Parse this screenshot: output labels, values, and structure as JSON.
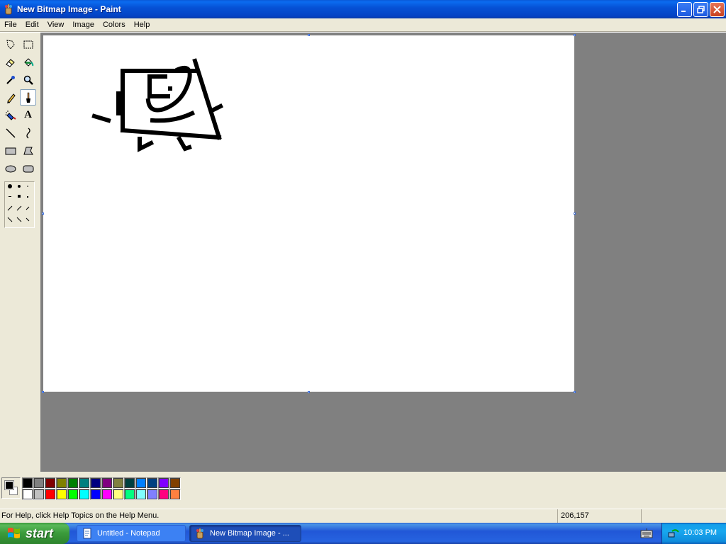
{
  "window": {
    "title": "New Bitmap Image - Paint",
    "buttons": {
      "minimize": "minimize-icon",
      "restore": "restore-icon",
      "close": "close-icon"
    }
  },
  "menu": [
    "File",
    "Edit",
    "View",
    "Image",
    "Colors",
    "Help"
  ],
  "tools": [
    {
      "name": "free-form-select-icon"
    },
    {
      "name": "select-icon"
    },
    {
      "name": "eraser-icon"
    },
    {
      "name": "fill-icon"
    },
    {
      "name": "pick-color-icon"
    },
    {
      "name": "magnifier-icon"
    },
    {
      "name": "pencil-icon"
    },
    {
      "name": "brush-icon",
      "active": true
    },
    {
      "name": "airbrush-icon"
    },
    {
      "name": "text-icon",
      "glyph": "A"
    },
    {
      "name": "line-icon"
    },
    {
      "name": "curve-icon"
    },
    {
      "name": "rectangle-icon"
    },
    {
      "name": "polygon-icon"
    },
    {
      "name": "ellipse-icon"
    },
    {
      "name": "rounded-rectangle-icon"
    }
  ],
  "palette": {
    "foreground": "#000000",
    "background": "#ffffff",
    "row1": [
      "#000000",
      "#808080",
      "#800000",
      "#808000",
      "#008000",
      "#008080",
      "#000080",
      "#800080",
      "#808040",
      "#004040",
      "#0080ff",
      "#004080",
      "#8000ff",
      "#804000"
    ],
    "row2": [
      "#ffffff",
      "#c0c0c0",
      "#ff0000",
      "#ffff00",
      "#00ff00",
      "#00ffff",
      "#0000ff",
      "#ff00ff",
      "#ffff80",
      "#00ff80",
      "#80ffff",
      "#8080ff",
      "#ff0080",
      "#ff8040"
    ]
  },
  "status": {
    "help": "For Help, click Help Topics on the Help Menu.",
    "coords": "206,157",
    "size": ""
  },
  "taskbar": {
    "start": "start",
    "tasks": [
      "Untitled - Notepad",
      "New Bitmap Image - ..."
    ],
    "clock": "10:03 PM"
  }
}
